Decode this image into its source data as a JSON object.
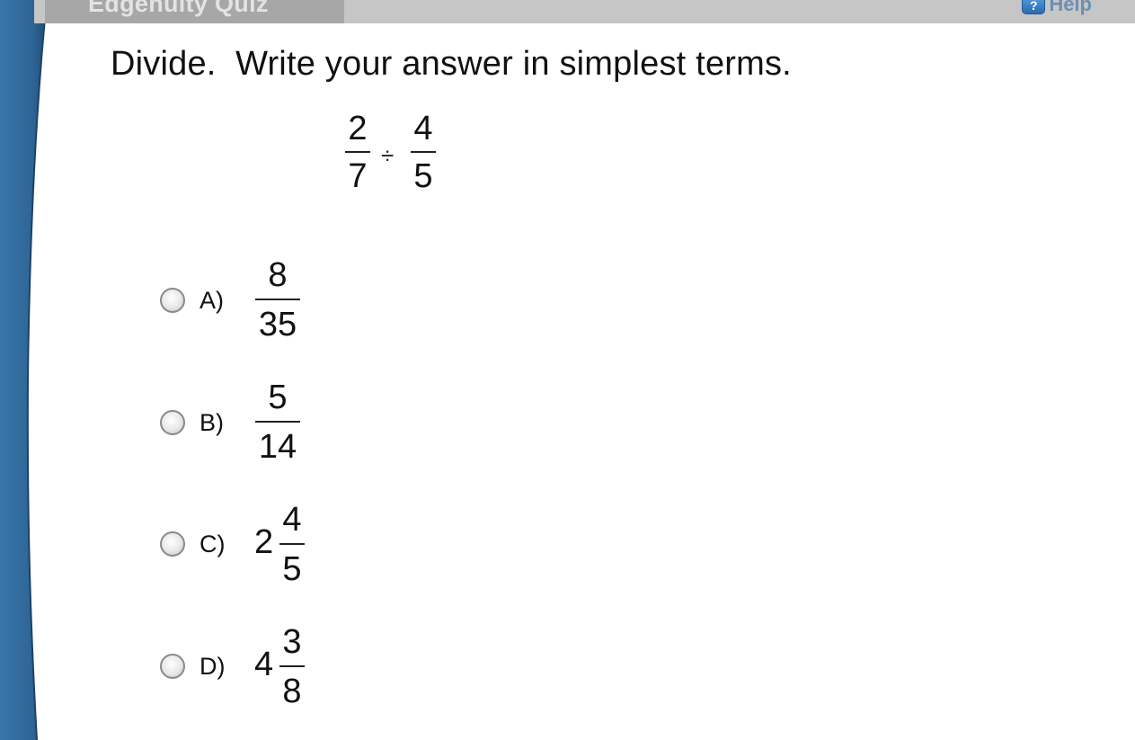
{
  "header": {
    "quiz_title": "Edgenuity Quiz",
    "help_label": "Help",
    "help_icon_glyph": "?"
  },
  "question": {
    "text": "Divide.  Write your answer in simplest terms.",
    "problem": {
      "left": {
        "numerator": "2",
        "denominator": "7"
      },
      "operator": "÷",
      "right": {
        "numerator": "4",
        "denominator": "5"
      }
    }
  },
  "choices": [
    {
      "letter": "A)",
      "whole": "",
      "numerator": "8",
      "denominator": "35"
    },
    {
      "letter": "B)",
      "whole": "",
      "numerator": "5",
      "denominator": "14"
    },
    {
      "letter": "C)",
      "whole": "2",
      "numerator": "4",
      "denominator": "5"
    },
    {
      "letter": "D)",
      "whole": "4",
      "numerator": "3",
      "denominator": "8"
    }
  ],
  "colors": {
    "frame_blue": "#2e6596",
    "frame_blue_dark": "#214c74",
    "topbar_gray": "#c6c6c6",
    "tab_gray": "#a7a7a7"
  }
}
